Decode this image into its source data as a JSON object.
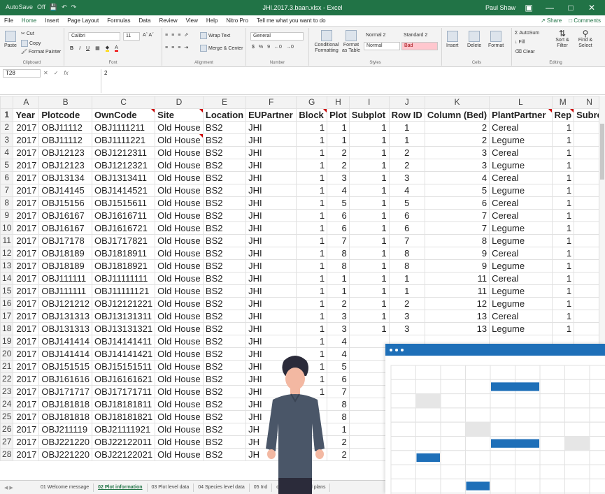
{
  "titlebar": {
    "quick_access": [
      "AutoSave",
      "Off",
      "save-icon",
      "undo-icon",
      "redo-icon"
    ],
    "document_title": "JHI.2017.3.baan.xlsx - Excel",
    "user": "Paul Shaw",
    "window_controls": [
      "ribbon-options-icon",
      "minimize-icon",
      "restore-icon",
      "close-icon"
    ]
  },
  "menu": {
    "tabs": [
      "File",
      "Home",
      "Insert",
      "Page Layout",
      "Formulas",
      "Data",
      "Review",
      "View",
      "Help",
      "Nitro Pro",
      "Tell me what you want to do"
    ],
    "active": "Home",
    "share": "Share",
    "comments": "Comments"
  },
  "ribbon": {
    "clipboard": {
      "paste": "Paste",
      "cut": "Cut",
      "copy": "Copy",
      "format_painter": "Format Painter",
      "label": "Clipboard"
    },
    "font": {
      "name": "Calibri",
      "size": "11",
      "bold": "B",
      "italic": "I",
      "underline": "U",
      "label": "Font"
    },
    "alignment": {
      "wrap": "Wrap Text",
      "merge": "Merge & Center",
      "label": "Alignment"
    },
    "number": {
      "format": "General",
      "currency": "$",
      "percent": "%",
      "comma": "9",
      "label": "Number"
    },
    "styles": {
      "conditional": "Conditional Formatting",
      "format_table": "Format as Table",
      "normal2": "Normal 2",
      "standard2": "Standard 2",
      "normal": "Normal",
      "bad": "Bad",
      "label": "Styles"
    },
    "cells": {
      "insert": "Insert",
      "delete": "Delete",
      "format": "Format",
      "label": "Cells"
    },
    "editing": {
      "autosum": "AutoSum",
      "fill": "Fill",
      "clear": "Clear",
      "sort": "Sort & Filter",
      "find": "Find & Select",
      "label": "Editing"
    },
    "accent": "#217346",
    "bad_fill": "#ffc7ce",
    "bad_text": "#9c0006"
  },
  "formula_bar": {
    "name_box": "T28",
    "fx": "fx",
    "value": "2"
  },
  "columns": [
    "A",
    "B",
    "C",
    "D",
    "E",
    "F",
    "G",
    "H",
    "I",
    "J",
    "K",
    "L",
    "M",
    "N"
  ],
  "header_row": [
    "Year",
    "Plotcode",
    "OwnCode",
    "Site",
    "Location",
    "EUPartner",
    "Block",
    "Plot",
    "Subplot",
    "Row ID",
    "Column (Bed)",
    "PlantPartner",
    "Rep",
    "Subre"
  ],
  "rows": [
    [
      "2017",
      "OBJ11112",
      "OBJ1111211",
      "Old House",
      "BS2",
      "JHI",
      "1",
      "1",
      "1",
      "1",
      "2",
      "Cereal",
      "1"
    ],
    [
      "2017",
      "OBJ11112",
      "OBJ1111221",
      "Old House",
      "BS2",
      "JHI",
      "1",
      "1",
      "1",
      "1",
      "2",
      "Legume",
      "1"
    ],
    [
      "2017",
      "OBJ12123",
      "OBJ1212311",
      "Old House",
      "BS2",
      "JHI",
      "1",
      "2",
      "1",
      "2",
      "3",
      "Cereal",
      "1"
    ],
    [
      "2017",
      "OBJ12123",
      "OBJ1212321",
      "Old House",
      "BS2",
      "JHI",
      "1",
      "2",
      "1",
      "2",
      "3",
      "Legume",
      "1"
    ],
    [
      "2017",
      "OBJ13134",
      "OBJ1313411",
      "Old House",
      "BS2",
      "JHI",
      "1",
      "3",
      "1",
      "3",
      "4",
      "Cereal",
      "1"
    ],
    [
      "2017",
      "OBJ14145",
      "OBJ1414521",
      "Old House",
      "BS2",
      "JHI",
      "1",
      "4",
      "1",
      "4",
      "5",
      "Legume",
      "1"
    ],
    [
      "2017",
      "OBJ15156",
      "OBJ1515611",
      "Old House",
      "BS2",
      "JHI",
      "1",
      "5",
      "1",
      "5",
      "6",
      "Cereal",
      "1"
    ],
    [
      "2017",
      "OBJ16167",
      "OBJ1616711",
      "Old House",
      "BS2",
      "JHI",
      "1",
      "6",
      "1",
      "6",
      "7",
      "Cereal",
      "1"
    ],
    [
      "2017",
      "OBJ16167",
      "OBJ1616721",
      "Old House",
      "BS2",
      "JHI",
      "1",
      "6",
      "1",
      "6",
      "7",
      "Legume",
      "1"
    ],
    [
      "2017",
      "OBJ17178",
      "OBJ1717821",
      "Old House",
      "BS2",
      "JHI",
      "1",
      "7",
      "1",
      "7",
      "8",
      "Legume",
      "1"
    ],
    [
      "2017",
      "OBJ18189",
      "OBJ1818911",
      "Old House",
      "BS2",
      "JHI",
      "1",
      "8",
      "1",
      "8",
      "9",
      "Cereal",
      "1"
    ],
    [
      "2017",
      "OBJ18189",
      "OBJ1818921",
      "Old House",
      "BS2",
      "JHI",
      "1",
      "8",
      "1",
      "8",
      "9",
      "Legume",
      "1"
    ],
    [
      "2017",
      "OBJ111111",
      "OBJ11111111",
      "Old House",
      "BS2",
      "JHI",
      "1",
      "1",
      "1",
      "1",
      "11",
      "Cereal",
      "1"
    ],
    [
      "2017",
      "OBJ111111",
      "OBJ11111121",
      "Old House",
      "BS2",
      "JHI",
      "1",
      "1",
      "1",
      "1",
      "11",
      "Legume",
      "1"
    ],
    [
      "2017",
      "OBJ121212",
      "OBJ12121221",
      "Old House",
      "BS2",
      "JHI",
      "1",
      "2",
      "1",
      "2",
      "12",
      "Legume",
      "1"
    ],
    [
      "2017",
      "OBJ131313",
      "OBJ13131311",
      "Old House",
      "BS2",
      "JHI",
      "1",
      "3",
      "1",
      "3",
      "13",
      "Cereal",
      "1"
    ],
    [
      "2017",
      "OBJ131313",
      "OBJ13131321",
      "Old House",
      "BS2",
      "JHI",
      "1",
      "3",
      "1",
      "3",
      "13",
      "Legume",
      "1"
    ],
    [
      "2017",
      "OBJ141414",
      "OBJ14141411",
      "Old House",
      "BS2",
      "JHI",
      "1",
      "4",
      "",
      "",
      "",
      "",
      ""
    ],
    [
      "2017",
      "OBJ141414",
      "OBJ14141421",
      "Old House",
      "BS2",
      "JHI",
      "1",
      "4",
      "",
      "",
      "",
      "",
      ""
    ],
    [
      "2017",
      "OBJ151515",
      "OBJ15151511",
      "Old House",
      "BS2",
      "JHI",
      "1",
      "5",
      "",
      "",
      "",
      "",
      ""
    ],
    [
      "2017",
      "OBJ161616",
      "OBJ16161621",
      "Old House",
      "BS2",
      "JHI",
      "1",
      "6",
      "",
      "",
      "",
      "",
      ""
    ],
    [
      "2017",
      "OBJ171717",
      "OBJ17171711",
      "Old House",
      "BS2",
      "JHI",
      "1",
      "7",
      "",
      "",
      "",
      "",
      ""
    ],
    [
      "2017",
      "OBJ181818",
      "OBJ18181811",
      "Old House",
      "BS2",
      "JHI",
      "",
      "8",
      "",
      "",
      "",
      "",
      ""
    ],
    [
      "2017",
      "OBJ181818",
      "OBJ18181821",
      "Old House",
      "BS2",
      "JHI",
      "",
      "8",
      "",
      "",
      "",
      "",
      ""
    ],
    [
      "2017",
      "OBJ211119",
      "OBJ21111921",
      "Old House",
      "BS2",
      "JH",
      "",
      "1",
      "",
      "",
      "",
      "",
      ""
    ],
    [
      "2017",
      "OBJ221220",
      "OBJ22122011",
      "Old House",
      "BS2",
      "JH",
      "",
      "2",
      "",
      "",
      "",
      "",
      ""
    ],
    [
      "2017",
      "OBJ221220",
      "OBJ22122021",
      "Old House",
      "BS2",
      "JH",
      "",
      "2",
      "",
      "",
      "",
      "",
      ""
    ]
  ],
  "sheet_tabs": [
    "01 Welcome message",
    "02 Plot information",
    "03 Plot level data",
    "04 Species level data",
    "05 Ind",
    "data",
    "07 Field plans"
  ],
  "active_sheet": "02 Plot information",
  "overlay": {
    "bar_color": "#1e6fb8",
    "cell_blue": "#1e6fb8",
    "cell_grey": "#e6e6e6"
  }
}
